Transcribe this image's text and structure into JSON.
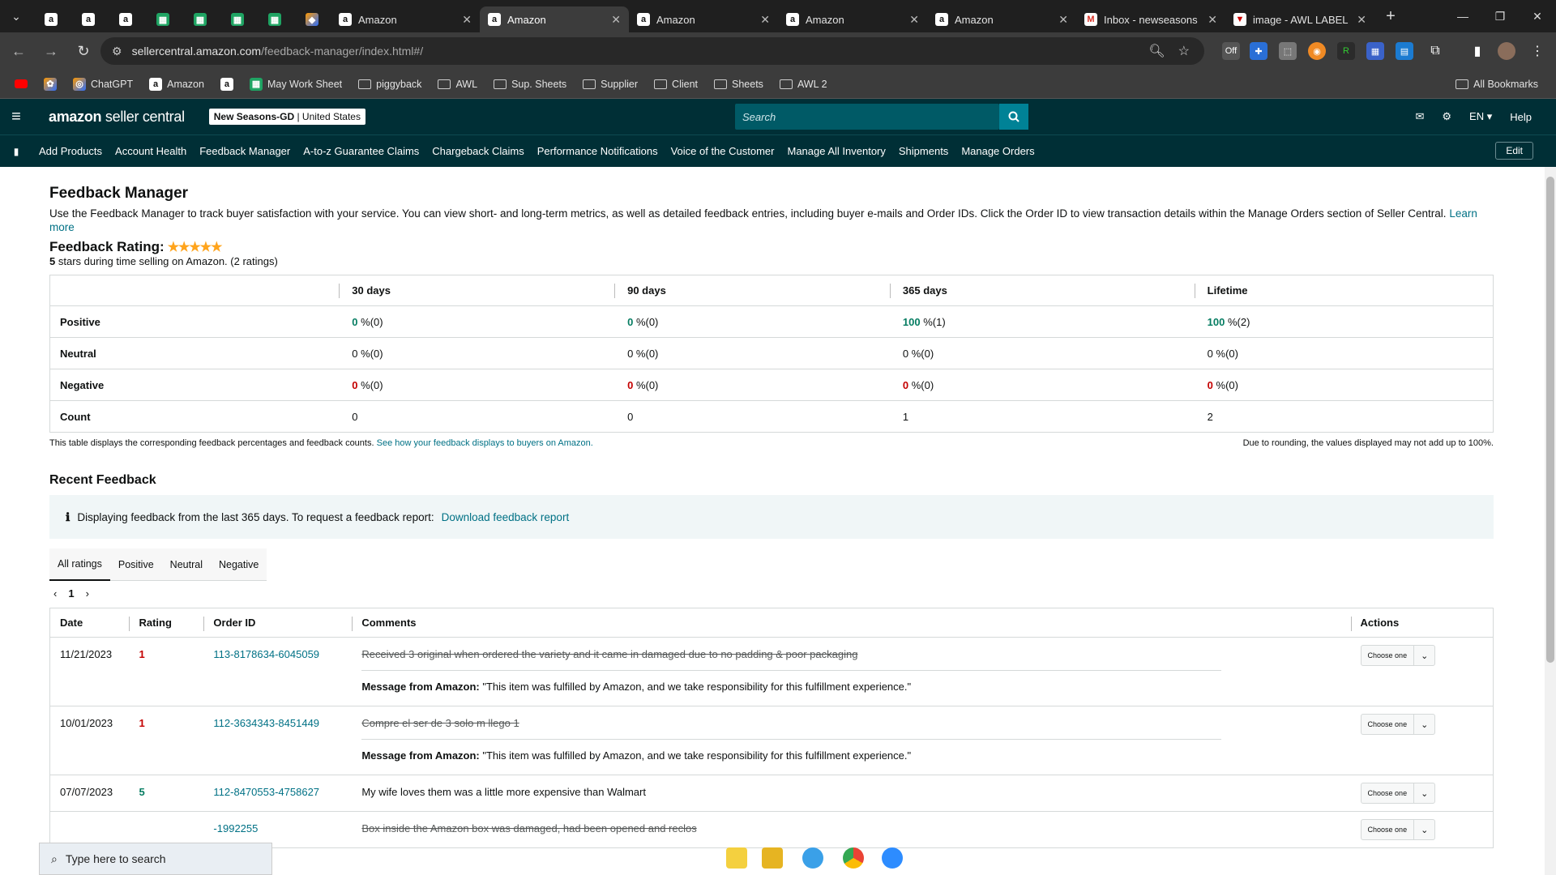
{
  "browser": {
    "tabs": [
      {
        "title": "",
        "icon": "amazon"
      },
      {
        "title": "",
        "icon": "amazon"
      },
      {
        "title": "",
        "icon": "amazon"
      },
      {
        "title": "",
        "icon": "sheets"
      },
      {
        "title": "",
        "icon": "sheets"
      },
      {
        "title": "",
        "icon": "sheets"
      },
      {
        "title": "",
        "icon": "sheets"
      },
      {
        "title": "",
        "icon": "multi"
      },
      {
        "title": "Amazon",
        "icon": "amazon"
      },
      {
        "title": "Amazon",
        "icon": "amazon",
        "active": true
      },
      {
        "title": "Amazon",
        "icon": "amazon"
      },
      {
        "title": "Amazon",
        "icon": "amazon"
      },
      {
        "title": "Amazon",
        "icon": "amazon"
      },
      {
        "title": "Inbox - newseasons",
        "icon": "gmail"
      },
      {
        "title": "image - AWL LABEL",
        "icon": "label"
      }
    ],
    "url_host": "sellercentral.amazon.com",
    "url_path": "/feedback-manager/index.html#/",
    "bookmarks": [
      {
        "label": "",
        "icon": "youtube"
      },
      {
        "label": "",
        "icon": "ext"
      },
      {
        "label": "ChatGPT",
        "icon": "chatgpt"
      },
      {
        "label": "Amazon",
        "icon": "amazon"
      },
      {
        "label": "",
        "icon": "amazon"
      },
      {
        "label": "May Work Sheet",
        "icon": "sheets"
      },
      {
        "label": "piggyback",
        "icon": "folder"
      },
      {
        "label": "AWL",
        "icon": "folder"
      },
      {
        "label": "Sup. Sheets",
        "icon": "folder"
      },
      {
        "label": "Supplier",
        "icon": "folder"
      },
      {
        "label": "Client",
        "icon": "folder"
      },
      {
        "label": "Sheets",
        "icon": "folder"
      },
      {
        "label": "AWL 2",
        "icon": "folder"
      }
    ],
    "all_bookmarks": "All Bookmarks"
  },
  "header": {
    "logo_bold": "amazon",
    "logo_light": "seller central",
    "store_name": "New Seasons-GD",
    "store_region": "| United States",
    "search_placeholder": "Search",
    "lang": "EN",
    "help": "Help"
  },
  "nav": {
    "items": [
      "Add Products",
      "Account Health",
      "Feedback Manager",
      "A-to-z Guarantee Claims",
      "Chargeback Claims",
      "Performance Notifications",
      "Voice of the Customer",
      "Manage All Inventory",
      "Shipments",
      "Manage Orders"
    ],
    "edit": "Edit"
  },
  "page": {
    "title": "Feedback Manager",
    "intro": "Use the Feedback Manager to track buyer satisfaction with your service. You can view short- and long-term metrics, as well as detailed feedback entries, including buyer e-mails and Order IDs. Click the Order ID to view transaction details within the Manage Orders section of Seller Central.",
    "learn_more": "Learn more",
    "rating_label": "Feedback Rating:",
    "stars": "★★★★★",
    "rating_value": 5,
    "rating_sub_count": "5",
    "rating_sub": " stars during time selling on Amazon. (2 ratings)"
  },
  "metrics": {
    "columns": [
      "30 days",
      "90 days",
      "365 days",
      "Lifetime"
    ],
    "rows": [
      {
        "label": "Positive",
        "cells": [
          [
            "0",
            " %(0)",
            "g"
          ],
          [
            "0",
            " %(0)",
            "g"
          ],
          [
            "100",
            " %(1)",
            "g"
          ],
          [
            "100",
            " %(2)",
            "g"
          ]
        ]
      },
      {
        "label": "Neutral",
        "cells": [
          [
            "0 %(0)",
            "",
            ""
          ],
          [
            "0 %(0)",
            "",
            ""
          ],
          [
            "0 %(0)",
            "",
            ""
          ],
          [
            "0 %(0)",
            "",
            ""
          ]
        ]
      },
      {
        "label": "Negative",
        "cells": [
          [
            "0",
            " %(0)",
            "r"
          ],
          [
            "0",
            " %(0)",
            "r"
          ],
          [
            "0",
            " %(0)",
            "r"
          ],
          [
            "0",
            " %(0)",
            "r"
          ]
        ]
      },
      {
        "label": "Count",
        "cells": [
          [
            "0",
            "",
            ""
          ],
          [
            "0",
            "",
            ""
          ],
          [
            "1",
            "",
            ""
          ],
          [
            "2",
            "",
            ""
          ]
        ]
      }
    ],
    "note_left": "This table displays the corresponding feedback percentages and feedback counts.",
    "note_link": "See how your feedback displays to buyers on Amazon.",
    "note_right": "Due to rounding, the values displayed may not add up to 100%."
  },
  "recent": {
    "title": "Recent Feedback",
    "info_text": "Displaying feedback from the last 365 days. To request a feedback report:",
    "info_link": "Download feedback report",
    "filters": [
      "All ratings",
      "Positive",
      "Neutral",
      "Negative"
    ],
    "page": "1",
    "columns": [
      "Date",
      "Rating",
      "Order ID",
      "Comments",
      "Actions"
    ],
    "rows": [
      {
        "date": "11/21/2023",
        "rating": "1",
        "rating_class": "r",
        "order": "113-8178634-6045059",
        "comment": "Received 3 original when ordered the variety and it came in damaged due to no padding & poor packaging",
        "struck": true,
        "msg_label": "Message from Amazon:",
        "msg": " \"This item was fulfilled by Amazon, and we take responsibility for this fulfillment experience.\"",
        "action": "Choose one"
      },
      {
        "date": "10/01/2023",
        "rating": "1",
        "rating_class": "r",
        "order": "112-3634343-8451449",
        "comment": "Compre el ser de 3 solo m llego 1",
        "struck": true,
        "msg_label": "Message from Amazon:",
        "msg": " \"This item was fulfilled by Amazon, and we take responsibility for this fulfillment experience.\"",
        "action": "Choose one"
      },
      {
        "date": "07/07/2023",
        "rating": "5",
        "rating_class": "g",
        "order": "112-8470553-4758627",
        "comment": "My wife loves them was a little more expensive than Walmart",
        "struck": false,
        "msg_label": "",
        "msg": "",
        "action": "Choose one"
      },
      {
        "date": "",
        "rating": "",
        "rating_class": "",
        "order": "-1992255",
        "comment": "Box inside the Amazon box was damaged, had been opened and reclos",
        "struck": true,
        "msg_label": "",
        "msg": "",
        "action": "Choose one"
      }
    ]
  },
  "taskbar": {
    "search_placeholder": "Type here to search"
  }
}
